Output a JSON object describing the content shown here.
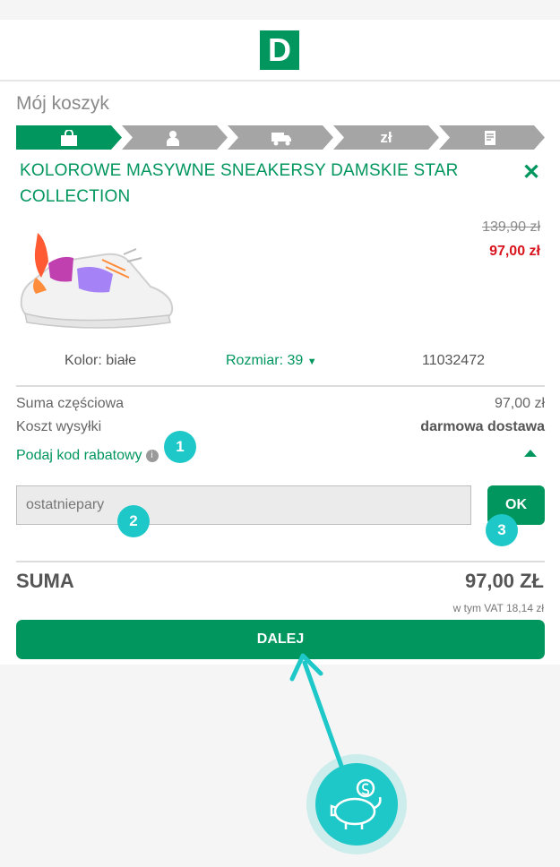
{
  "brand": {
    "logo_letter": "D",
    "color": "#00965e"
  },
  "cart": {
    "title": "Mój koszyk"
  },
  "steps": [
    {
      "name": "cart",
      "icon": "shopping-bag-icon",
      "active": true
    },
    {
      "name": "account",
      "icon": "user-icon",
      "active": false
    },
    {
      "name": "delivery",
      "icon": "truck-icon",
      "active": false
    },
    {
      "name": "payment",
      "label": "zł",
      "active": false
    },
    {
      "name": "summary",
      "icon": "document-icon",
      "active": false
    }
  ],
  "product": {
    "title": "KOLOROWE MASYWNE SNEAKERSY DAMSKIE STAR COLLECTION",
    "old_price": "139,90 zł",
    "new_price": "97,00 zł",
    "color": "Kolor: białe",
    "size": "Rozmiar: 39",
    "code": "11032472"
  },
  "summary": {
    "subtotal_label": "Suma częściowa",
    "subtotal_value": "97,00 zł",
    "shipping_label": "Koszt wysyłki",
    "shipping_value": "darmowa dostawa",
    "promo_label": "Podaj kod rabatowy",
    "promo_input_value": "ostatniepary",
    "ok_label": "OK",
    "total_label": "SUMA",
    "total_value": "97,00 ZŁ",
    "vat": "w tym VAT 18,14 zł",
    "next_label": "DALEJ"
  },
  "annotations": [
    "1",
    "2",
    "3"
  ],
  "colors": {
    "accent": "#00965e",
    "sale": "#d8141e",
    "annotation": "#1ec8c8"
  }
}
